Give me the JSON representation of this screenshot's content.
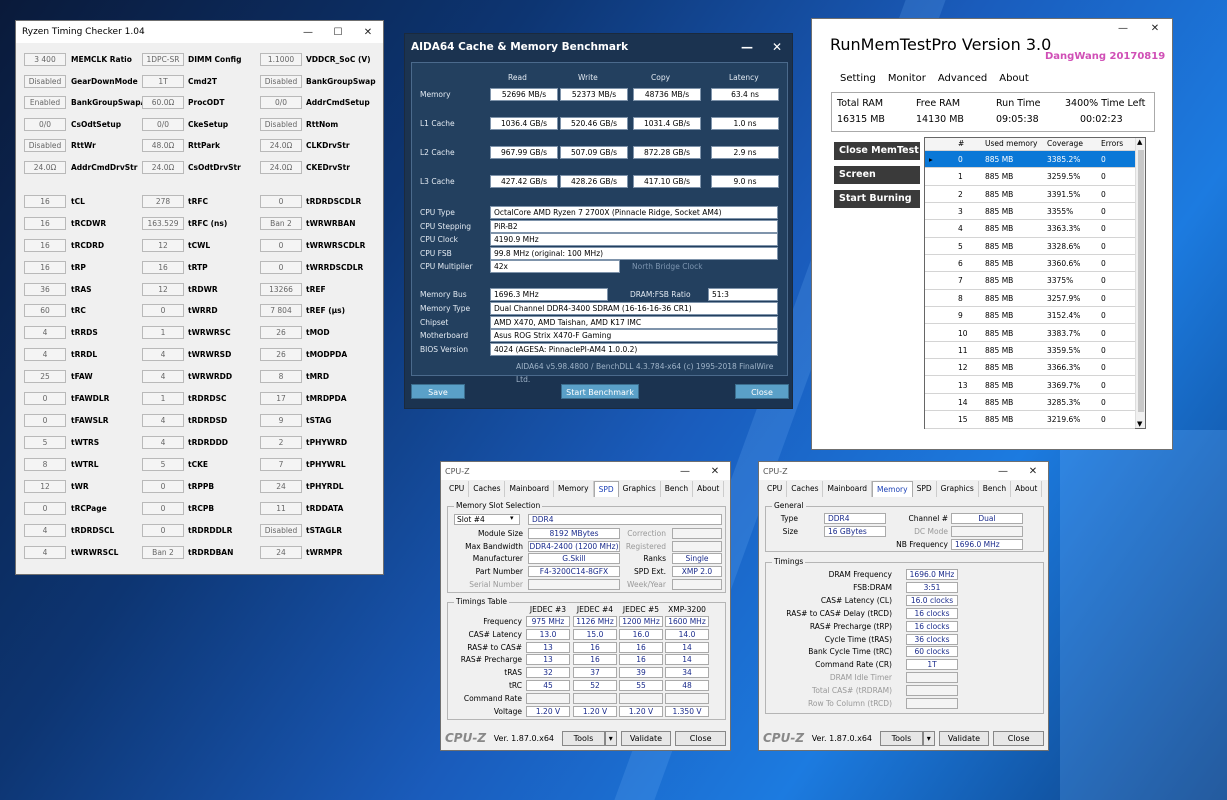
{
  "rtc": {
    "title": "Ryzen Timing Checker 1.04",
    "rows": [
      [
        "3 400",
        "MEMCLK Ratio",
        "1DPC-SR",
        "DIMM Config",
        "1.1000",
        "VDDCR_SoC (V)"
      ],
      [
        "Disabled",
        "GearDownMode",
        "1T",
        "Cmd2T",
        "Disabled",
        "BankGroupSwap"
      ],
      [
        "Enabled",
        "BankGroupSwapAlt",
        "60.0Ω",
        "ProcODT",
        "0/0",
        "AddrCmdSetup"
      ],
      [
        "0/0",
        "CsOdtSetup",
        "0/0",
        "CkeSetup",
        "Disabled",
        "RttNom"
      ],
      [
        "Disabled",
        "RttWr",
        "48.0Ω",
        "RttPark",
        "24.0Ω",
        "CLKDrvStr"
      ],
      [
        "24.0Ω",
        "AddrCmdDrvStr",
        "24.0Ω",
        "CsOdtDrvStr",
        "24.0Ω",
        "CKEDrvStr"
      ],
      [
        "16",
        "tCL",
        "278",
        "tRFC",
        "0",
        "tRDRDSCDLR"
      ],
      [
        "16",
        "tRCDWR",
        "163.529",
        "tRFC (ns)",
        "Ban 2",
        "tWRWRBAN"
      ],
      [
        "16",
        "tRCDRD",
        "12",
        "tCWL",
        "0",
        "tWRWRSCDLR"
      ],
      [
        "16",
        "tRP",
        "16",
        "tRTP",
        "0",
        "tWRRDSCDLR"
      ],
      [
        "36",
        "tRAS",
        "12",
        "tRDWR",
        "13266",
        "tREF"
      ],
      [
        "60",
        "tRC",
        "0",
        "tWRRD",
        "7 804",
        "tREF (µs)"
      ],
      [
        "4",
        "tRRDS",
        "1",
        "tWRWRSC",
        "26",
        "tMOD"
      ],
      [
        "4",
        "tRRDL",
        "4",
        "tWRWRSD",
        "26",
        "tMODPDA"
      ],
      [
        "25",
        "tFAW",
        "4",
        "tWRWRDD",
        "8",
        "tMRD"
      ],
      [
        "0",
        "tFAWDLR",
        "1",
        "tRDRDSC",
        "17",
        "tMRDPDA"
      ],
      [
        "0",
        "tFAWSLR",
        "4",
        "tRDRDSD",
        "9",
        "tSTAG"
      ],
      [
        "5",
        "tWTRS",
        "4",
        "tRDRDDD",
        "2",
        "tPHYWRD"
      ],
      [
        "8",
        "tWTRL",
        "5",
        "tCKE",
        "7",
        "tPHYWRL"
      ],
      [
        "12",
        "tWR",
        "0",
        "tRPPB",
        "24",
        "tPHYRDL"
      ],
      [
        "0",
        "tRCPage",
        "0",
        "tRCPB",
        "11",
        "tRDDATA"
      ],
      [
        "4",
        "tRDRDSCL",
        "0",
        "tRDRDDLR",
        "Disabled",
        "tSTAGLR"
      ],
      [
        "4",
        "tWRWRSCL",
        "Ban 2",
        "tRDRDBAN",
        "24",
        "tWRMPR"
      ]
    ]
  },
  "aida": {
    "title": "AIDA64 Cache & Memory Benchmark",
    "headers": [
      "Read",
      "Write",
      "Copy",
      "Latency"
    ],
    "bench": [
      {
        "label": "Memory",
        "vals": [
          "52696 MB/s",
          "52373 MB/s",
          "48736 MB/s",
          "63.4 ns"
        ]
      },
      {
        "label": "L1 Cache",
        "vals": [
          "1036.4 GB/s",
          "520.46 GB/s",
          "1031.4 GB/s",
          "1.0 ns"
        ]
      },
      {
        "label": "L2 Cache",
        "vals": [
          "967.99 GB/s",
          "507.09 GB/s",
          "872.28 GB/s",
          "2.9 ns"
        ]
      },
      {
        "label": "L3 Cache",
        "vals": [
          "427.42 GB/s",
          "428.26 GB/s",
          "417.10 GB/s",
          "9.0 ns"
        ]
      }
    ],
    "cpu": [
      {
        "label": "CPU Type",
        "val": "OctalCore AMD Ryzen 7 2700X  (Pinnacle Ridge, Socket AM4)"
      },
      {
        "label": "CPU Stepping",
        "val": "PiR-B2"
      },
      {
        "label": "CPU Clock",
        "val": "4190.9 MHz"
      },
      {
        "label": "CPU FSB",
        "val": "99.8 MHz  (original: 100 MHz)"
      },
      {
        "label": "CPU Multiplier",
        "val": "42x"
      }
    ],
    "nb_label": "North Bridge Clock",
    "membus_label": "Memory Bus",
    "membus": "1696.3 MHz",
    "ratio_label": "DRAM:FSB Ratio",
    "ratio": "51:3",
    "mem": [
      {
        "label": "Memory Type",
        "val": "Dual Channel DDR4-3400 SDRAM  (16-16-16-36 CR1)"
      },
      {
        "label": "Chipset",
        "val": "AMD X470, AMD Taishan, AMD K17 IMC"
      },
      {
        "label": "Motherboard",
        "val": "Asus ROG Strix X470-F Gaming"
      },
      {
        "label": "BIOS Version",
        "val": "4024  (AGESA: PinnaclePI-AM4 1.0.0.2)"
      }
    ],
    "footer": "AIDA64 v5.98.4800 / BenchDLL 4.3.784-x64  (c) 1995-2018 FinalWire Ltd.",
    "save": "Save",
    "start": "Start Benchmark",
    "close": "Close"
  },
  "rmt": {
    "title": "RunMemTestPro Version 3.0",
    "sig": "DangWang  20170819",
    "tabs": [
      "Setting",
      "Monitor",
      "Advanced",
      "About"
    ],
    "stat_h": [
      "Total RAM",
      "Free RAM",
      "Run Time",
      "3400% Time Left"
    ],
    "stat_v": [
      "16315 MB",
      "14130 MB",
      "09:05:38",
      "00:02:23"
    ],
    "buttons": [
      "Close MemTest",
      "Screen Capture",
      "Start Burning"
    ],
    "cols": [
      "#",
      "Used memory",
      "Coverage",
      "Errors"
    ],
    "rows": [
      [
        "0",
        "885 MB",
        "3385.2%",
        "0"
      ],
      [
        "1",
        "885 MB",
        "3259.5%",
        "0"
      ],
      [
        "2",
        "885 MB",
        "3391.5%",
        "0"
      ],
      [
        "3",
        "885 MB",
        "3355%",
        "0"
      ],
      [
        "4",
        "885 MB",
        "3363.3%",
        "0"
      ],
      [
        "5",
        "885 MB",
        "3328.6%",
        "0"
      ],
      [
        "6",
        "885 MB",
        "3360.6%",
        "0"
      ],
      [
        "7",
        "885 MB",
        "3375%",
        "0"
      ],
      [
        "8",
        "885 MB",
        "3257.9%",
        "0"
      ],
      [
        "9",
        "885 MB",
        "3152.4%",
        "0"
      ],
      [
        "10",
        "885 MB",
        "3383.7%",
        "0"
      ],
      [
        "11",
        "885 MB",
        "3359.5%",
        "0"
      ],
      [
        "12",
        "885 MB",
        "3366.3%",
        "0"
      ],
      [
        "13",
        "885 MB",
        "3369.7%",
        "0"
      ],
      [
        "14",
        "885 MB",
        "3285.3%",
        "0"
      ],
      [
        "15",
        "885 MB",
        "3219.6%",
        "0"
      ]
    ]
  },
  "cz1": {
    "title": "CPU-Z",
    "tabs": [
      "CPU",
      "Caches",
      "Mainboard",
      "Memory",
      "SPD",
      "Graphics",
      "Bench",
      "About"
    ],
    "grp1": "Memory Slot Selection",
    "slot": "Slot #4",
    "type": "DDR4",
    "left": [
      [
        "Module Size",
        "8192 MBytes"
      ],
      [
        "Max Bandwidth",
        "DDR4-2400 (1200 MHz)"
      ],
      [
        "Manufacturer",
        "G.Skill"
      ],
      [
        "Part Number",
        "F4-3200C14-8GFX"
      ],
      [
        "Serial Number",
        ""
      ]
    ],
    "right": [
      [
        "Correction",
        ""
      ],
      [
        "Registered",
        ""
      ],
      [
        "Ranks",
        "Single"
      ],
      [
        "SPD Ext.",
        "XMP 2.0"
      ],
      [
        "Week/Year",
        ""
      ]
    ],
    "grp2": "Timings Table",
    "tcols": [
      "JEDEC #3",
      "JEDEC #4",
      "JEDEC #5",
      "XMP-3200"
    ],
    "trows": [
      [
        "Frequency",
        "975 MHz",
        "1126 MHz",
        "1200 MHz",
        "1600 MHz"
      ],
      [
        "CAS# Latency",
        "13.0",
        "15.0",
        "16.0",
        "14.0"
      ],
      [
        "RAS# to CAS#",
        "13",
        "16",
        "16",
        "14"
      ],
      [
        "RAS# Precharge",
        "13",
        "16",
        "16",
        "14"
      ],
      [
        "tRAS",
        "32",
        "37",
        "39",
        "34"
      ],
      [
        "tRC",
        "45",
        "52",
        "55",
        "48"
      ],
      [
        "Command Rate",
        "",
        "",
        "",
        ""
      ],
      [
        "Voltage",
        "1.20 V",
        "1.20 V",
        "1.20 V",
        "1.350 V"
      ]
    ],
    "logo": "CPU-Z",
    "ver": "Ver. 1.87.0.x64",
    "tools": "Tools",
    "validate": "Validate",
    "close": "Close"
  },
  "cz2": {
    "title": "CPU-Z",
    "tabs": [
      "CPU",
      "Caches",
      "Mainboard",
      "Memory",
      "SPD",
      "Graphics",
      "Bench",
      "About"
    ],
    "grp1": "General",
    "type_l": "Type",
    "type": "DDR4",
    "size_l": "Size",
    "size": "16 GBytes",
    "ch_l": "Channel #",
    "ch": "Dual",
    "dc_l": "DC Mode",
    "dc": "",
    "nb_l": "NB Frequency",
    "nb": "1696.0 MHz",
    "grp2": "Timings",
    "timings": [
      [
        "DRAM Frequency",
        "1696.0 MHz"
      ],
      [
        "FSB:DRAM",
        "3:51"
      ],
      [
        "CAS# Latency (CL)",
        "16.0 clocks"
      ],
      [
        "RAS# to CAS# Delay (tRCD)",
        "16 clocks"
      ],
      [
        "RAS# Precharge (tRP)",
        "16 clocks"
      ],
      [
        "Cycle Time (tRAS)",
        "36 clocks"
      ],
      [
        "Bank Cycle Time (tRC)",
        "60 clocks"
      ],
      [
        "Command Rate (CR)",
        "1T"
      ],
      [
        "DRAM Idle Timer",
        ""
      ],
      [
        "Total CAS# (tRDRAM)",
        ""
      ],
      [
        "Row To Column (tRCD)",
        ""
      ]
    ],
    "logo": "CPU-Z",
    "ver": "Ver. 1.87.0.x64",
    "tools": "Tools",
    "validate": "Validate",
    "close": "Close"
  }
}
